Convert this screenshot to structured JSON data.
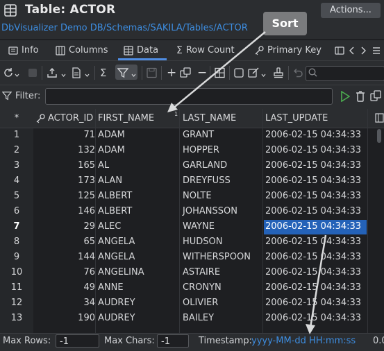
{
  "window": {
    "title": "Table: ACTOR",
    "actions_label": "Actions..."
  },
  "path": "DbVisualizer Demo DB/Schemas/SAKILA/Tables/ACTOR",
  "tabs": [
    {
      "label": "Info",
      "icon": "info-icon"
    },
    {
      "label": "Columns",
      "icon": "columns-icon"
    },
    {
      "label": "Data",
      "icon": "table-icon",
      "active": true
    },
    {
      "label": "Row Count",
      "icon": "sigma-icon"
    },
    {
      "label": "Primary Key",
      "icon": "key-icon"
    }
  ],
  "filter": {
    "label": "Filter:"
  },
  "grid": {
    "row_marker": "*",
    "columns": [
      "ACTOR_ID",
      "FIRST_NAME",
      "LAST_NAME",
      "LAST_UPDATE"
    ],
    "sort_indicator": "1",
    "rows": [
      [
        "1",
        "71",
        "ADAM",
        "GRANT",
        "2006-02-15 04:34:33"
      ],
      [
        "2",
        "132",
        "ADAM",
        "HOPPER",
        "2006-02-15 04:34:33"
      ],
      [
        "3",
        "165",
        "AL",
        "GARLAND",
        "2006-02-15 04:34:33"
      ],
      [
        "4",
        "173",
        "ALAN",
        "DREYFUSS",
        "2006-02-15 04:34:33"
      ],
      [
        "5",
        "125",
        "ALBERT",
        "NOLTE",
        "2006-02-15 04:34:33"
      ],
      [
        "6",
        "146",
        "ALBERT",
        "JOHANSSON",
        "2006-02-15 04:34:33"
      ],
      [
        "7",
        "29",
        "ALEC",
        "WAYNE",
        "2006-02-15 04:34:33"
      ],
      [
        "8",
        "65",
        "ANGELA",
        "HUDSON",
        "2006-02-15 04:34:33"
      ],
      [
        "9",
        "144",
        "ANGELA",
        "WITHERSPOON",
        "2006-02-15 04:34:33"
      ],
      [
        "10",
        "76",
        "ANGELINA",
        "ASTAIRE",
        "2006-02-15 04:34:33"
      ],
      [
        "11",
        "49",
        "ANNE",
        "CRONYN",
        "2006-02-15 04:34:33"
      ],
      [
        "12",
        "34",
        "AUDREY",
        "OLIVIER",
        "2006-02-15 04:34:33"
      ],
      [
        "13",
        "190",
        "AUDREY",
        "BAILEY",
        "2006-02-15 04:34:33"
      ]
    ],
    "selected_row": "7"
  },
  "status": {
    "max_rows_label": "Max Rows:",
    "max_rows_value": "-1",
    "max_chars_label": "Max Chars:",
    "max_chars_value": "-1",
    "timestamp_label": "Timestamp:",
    "timestamp_format": "yyyy-MM-dd HH:mm:ss",
    "trailing": "0.0"
  },
  "annotation": {
    "label": "Sort"
  },
  "colors": {
    "accent": "#3d8de0",
    "selection": "#2462b8",
    "background": "#1e1f22",
    "panel": "#2b2d30"
  }
}
